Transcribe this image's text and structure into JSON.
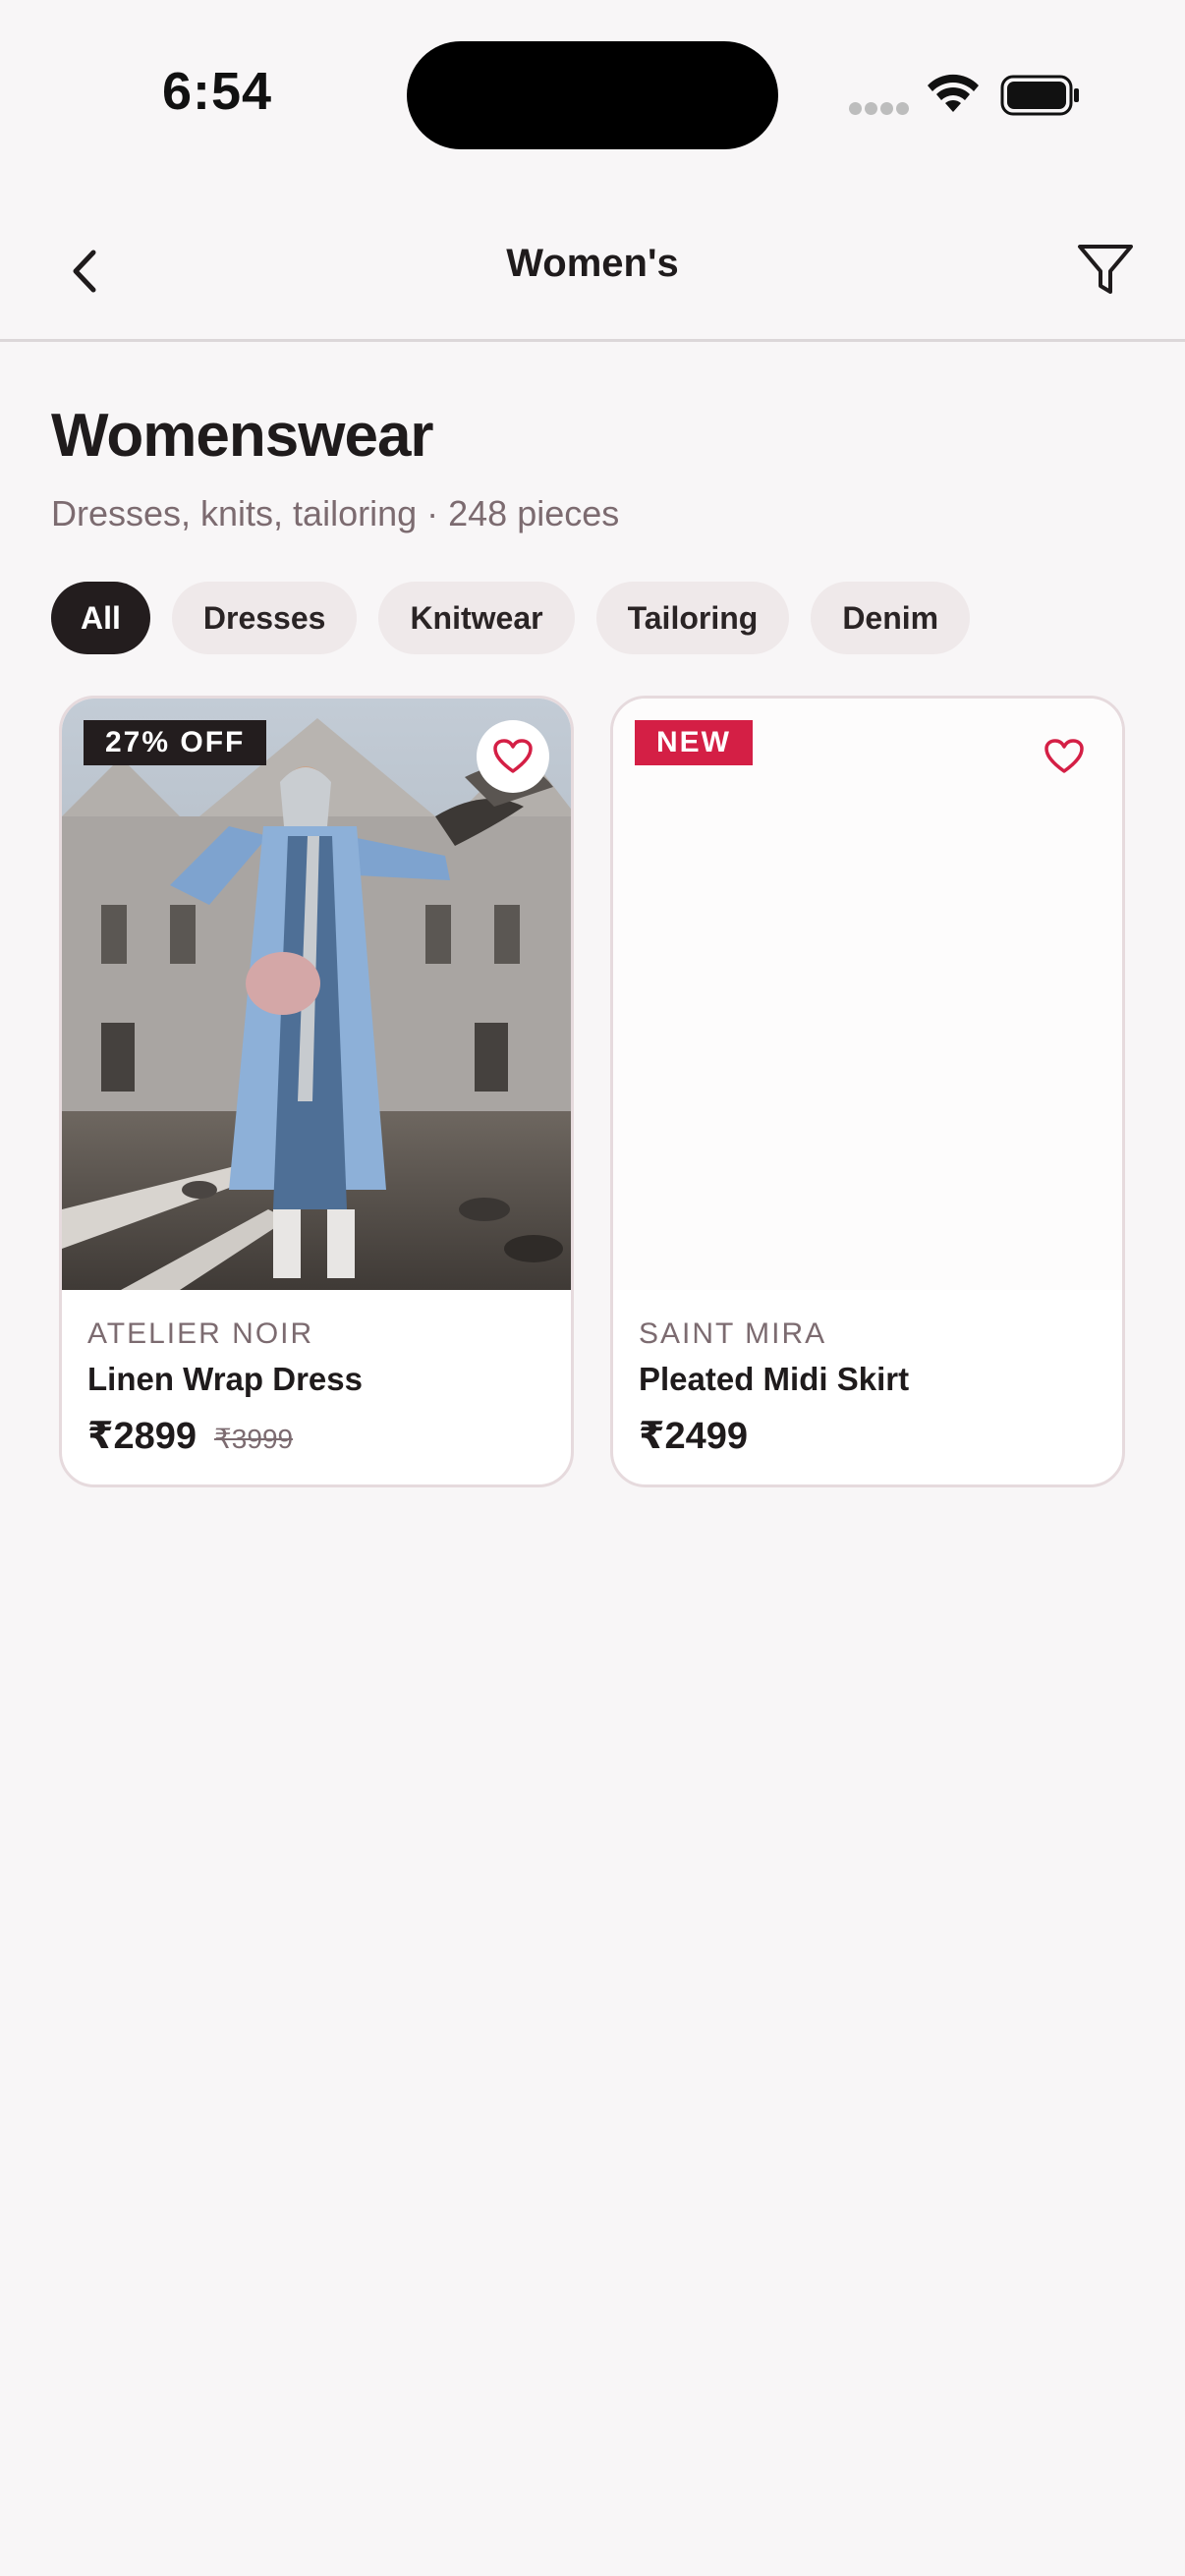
{
  "status_bar": {
    "time": "6:54"
  },
  "nav": {
    "title": "Women's",
    "back_icon": "chevron-left-icon",
    "filter_icon": "filter-funnel-icon"
  },
  "header": {
    "title": "Womenswear",
    "subtitle": "Dresses, knits, tailoring · 248 pieces"
  },
  "chips": [
    {
      "label": "All",
      "active": true
    },
    {
      "label": "Dresses",
      "active": false
    },
    {
      "label": "Knitwear",
      "active": false
    },
    {
      "label": "Tailoring",
      "active": false
    },
    {
      "label": "Denim",
      "active": false
    }
  ],
  "products": [
    {
      "badge": "27% OFF",
      "brand": "ATELIER NOIR",
      "name": "Linen Wrap Dress",
      "price": "₹2899",
      "old_price": "₹3999",
      "has_image": true
    },
    {
      "badge": "NEW",
      "brand": "SAINT MIRA",
      "name": "Pleated Midi Skirt",
      "price": "₹2499",
      "has_image": false
    }
  ],
  "colors": {
    "background": "#f8f6f7",
    "accent_red": "#d41f45",
    "chip_active": "#231d1e",
    "chip_inactive": "#efe9ea",
    "muted_text": "#7c6b70"
  }
}
